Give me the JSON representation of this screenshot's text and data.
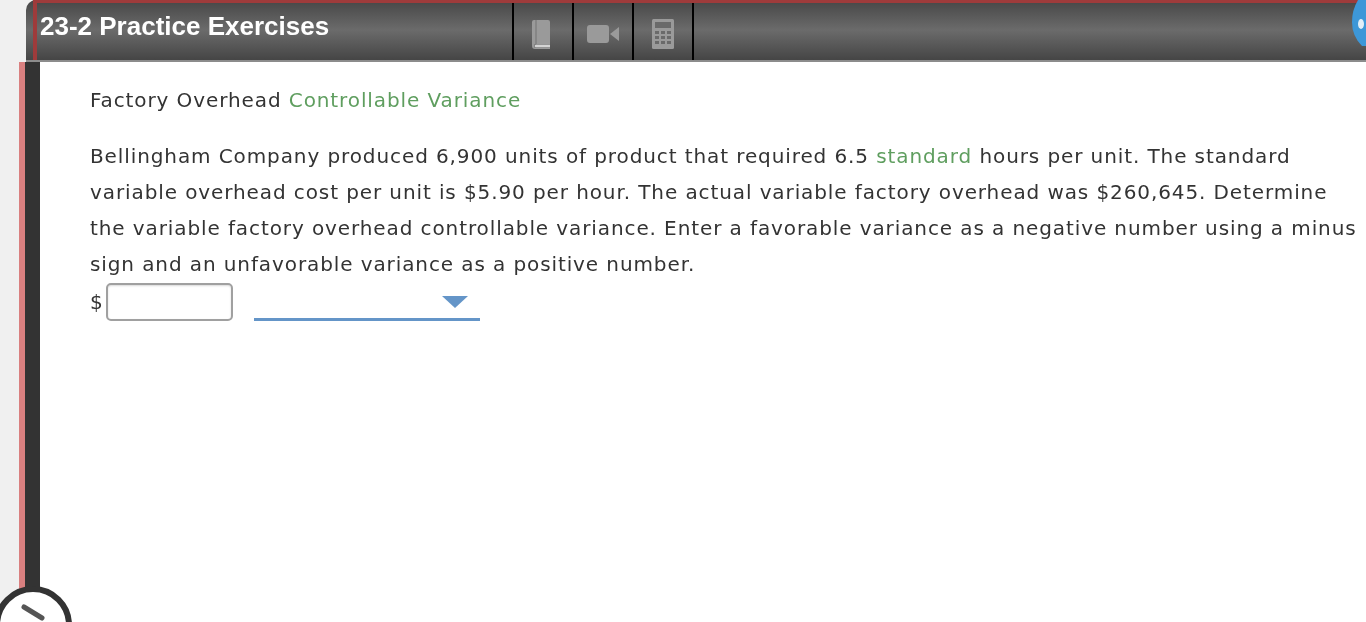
{
  "header": {
    "title": "23-2 Practice Exercises",
    "tools": [
      {
        "kind": "book"
      },
      {
        "kind": "video"
      },
      {
        "kind": "calculator"
      }
    ]
  },
  "question": {
    "heading": [
      {
        "kind": "text",
        "text": "Factory Overhead "
      },
      {
        "kind": "link",
        "text": "Controllable Variance"
      }
    ],
    "body": [
      {
        "kind": "text",
        "text": "Bellingham Company produced 6,900 units of product that required 6.5 "
      },
      {
        "kind": "link",
        "text": "standard"
      },
      {
        "kind": "text",
        "text": " hours per unit. The standard variable overhead cost per unit is $5.90 per hour. The actual variable factory overhead was $260,645. Determine the variable factory overhead controllable variance. Enter a favorable variance as a negative number using a minus sign and an unfavorable variance as a positive number."
      }
    ],
    "answer": {
      "currency": "$"
    }
  }
}
